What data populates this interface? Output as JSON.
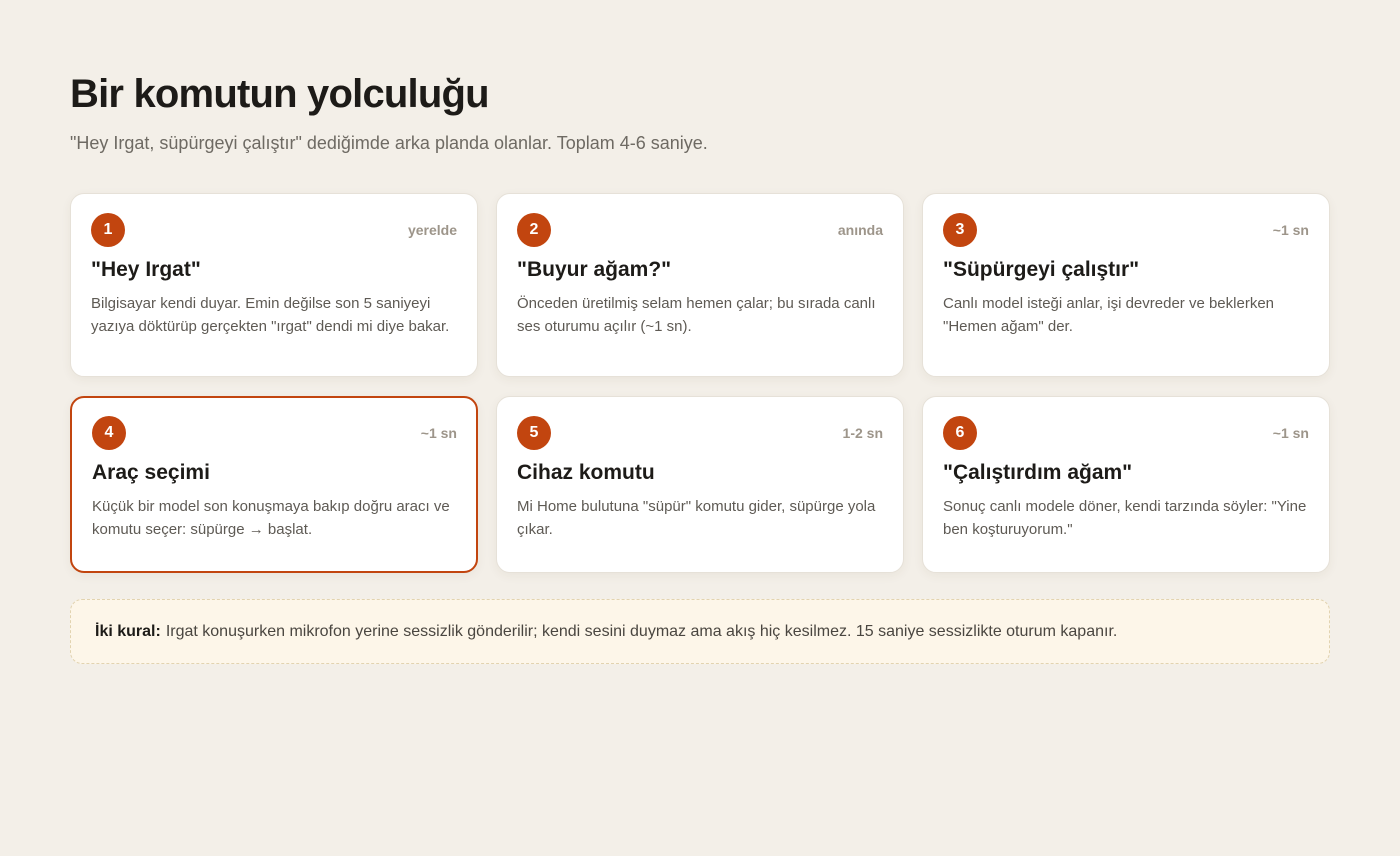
{
  "header": {
    "title": "Bir komutun yolculuğu",
    "subtitle": "\"Hey Irgat, süpürgeyi çalıştır\" dediğimde arka planda olanlar. Toplam 4-6 saniye."
  },
  "steps": [
    {
      "number": "1",
      "time": "yerelde",
      "title": "\"Hey Irgat\"",
      "description": "Bilgisayar kendi duyar. Emin değilse son 5 saniyeyi yazıya döktürüp gerçekten \"ırgat\" dendi mi diye bakar."
    },
    {
      "number": "2",
      "time": "anında",
      "title": "\"Buyur ağam?\"",
      "description": "Önceden üretilmiş selam hemen çalar; bu sırada canlı ses oturumu açılır (~1 sn)."
    },
    {
      "number": "3",
      "time": "~1 sn",
      "title": "\"Süpürgeyi çalıştır\"",
      "description": "Canlı model isteği anlar, işi devreder ve beklerken \"Hemen ağam\" der."
    },
    {
      "number": "4",
      "time": "~1 sn",
      "title": "Araç seçimi",
      "description": "Küçük bir model son konuşmaya bakıp doğru aracı ve komutu seçer: süpürge → başlat."
    },
    {
      "number": "5",
      "time": "1-2 sn",
      "title": "Cihaz komutu",
      "description": "Mi Home bulutuna \"süpür\" komutu gider, süpürge yola çıkar."
    },
    {
      "number": "6",
      "time": "~1 sn",
      "title": "\"Çalıştırdım ağam\"",
      "description": "Sonuç canlı modele döner, kendi tarzında söyler: \"Yine ben koşturuyorum.\""
    }
  ],
  "note": {
    "label": "İki kural:",
    "text": "Irgat konuşurken mikrofon yerine sessizlik gönderilir; kendi sesini duymaz ama akış hiç kesilmez. 15 saniye sessizlikte oturum kapanır."
  },
  "colors": {
    "background": "#f3efe8",
    "accent": "#c2450f",
    "card": "#ffffff",
    "note_background": "#fdf6e9"
  }
}
